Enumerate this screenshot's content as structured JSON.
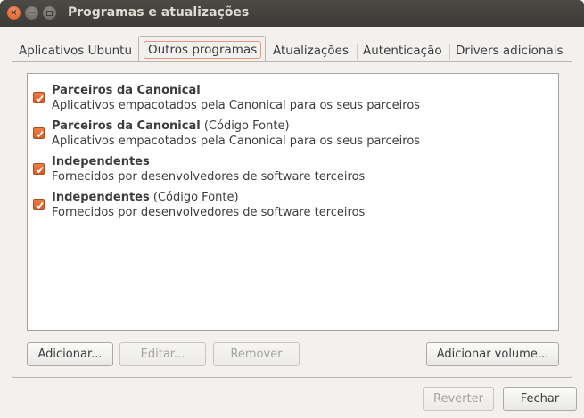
{
  "window": {
    "title": "Programas e atualizações",
    "controls": {
      "close_glyph": "×",
      "minimize_glyph": "−"
    }
  },
  "tabs": [
    {
      "label": "Aplicativos Ubuntu",
      "active": false
    },
    {
      "label": "Outros programas",
      "active": true
    },
    {
      "label": "Atualizações",
      "active": false
    },
    {
      "label": "Autenticação",
      "active": false
    },
    {
      "label": "Drivers adicionais",
      "active": false
    }
  ],
  "sources": [
    {
      "title_bold": "Parceiros da Canonical",
      "title_suffix": "",
      "description": "Aplicativos empacotados pela Canonical para os seus parceiros",
      "checked": true
    },
    {
      "title_bold": "Parceiros da Canonical",
      "title_suffix": " (Código Fonte)",
      "description": "Aplicativos empacotados pela Canonical para os seus parceiros",
      "checked": true
    },
    {
      "title_bold": "Independentes",
      "title_suffix": "",
      "description": "Fornecidos por desenvolvedores de software terceiros",
      "checked": true
    },
    {
      "title_bold": "Independentes",
      "title_suffix": " (Código Fonte)",
      "description": "Fornecidos por desenvolvedores de software terceiros",
      "checked": true
    }
  ],
  "buttons": {
    "add": "Adicionar...",
    "edit": "Editar...",
    "remove": "Remover",
    "add_volume": "Adicionar volume...",
    "revert": "Reverter",
    "close": "Fechar"
  },
  "colors": {
    "accent": "#e05a1e",
    "titlebar": "#3c3b37",
    "window_bg": "#f2f1f0"
  }
}
